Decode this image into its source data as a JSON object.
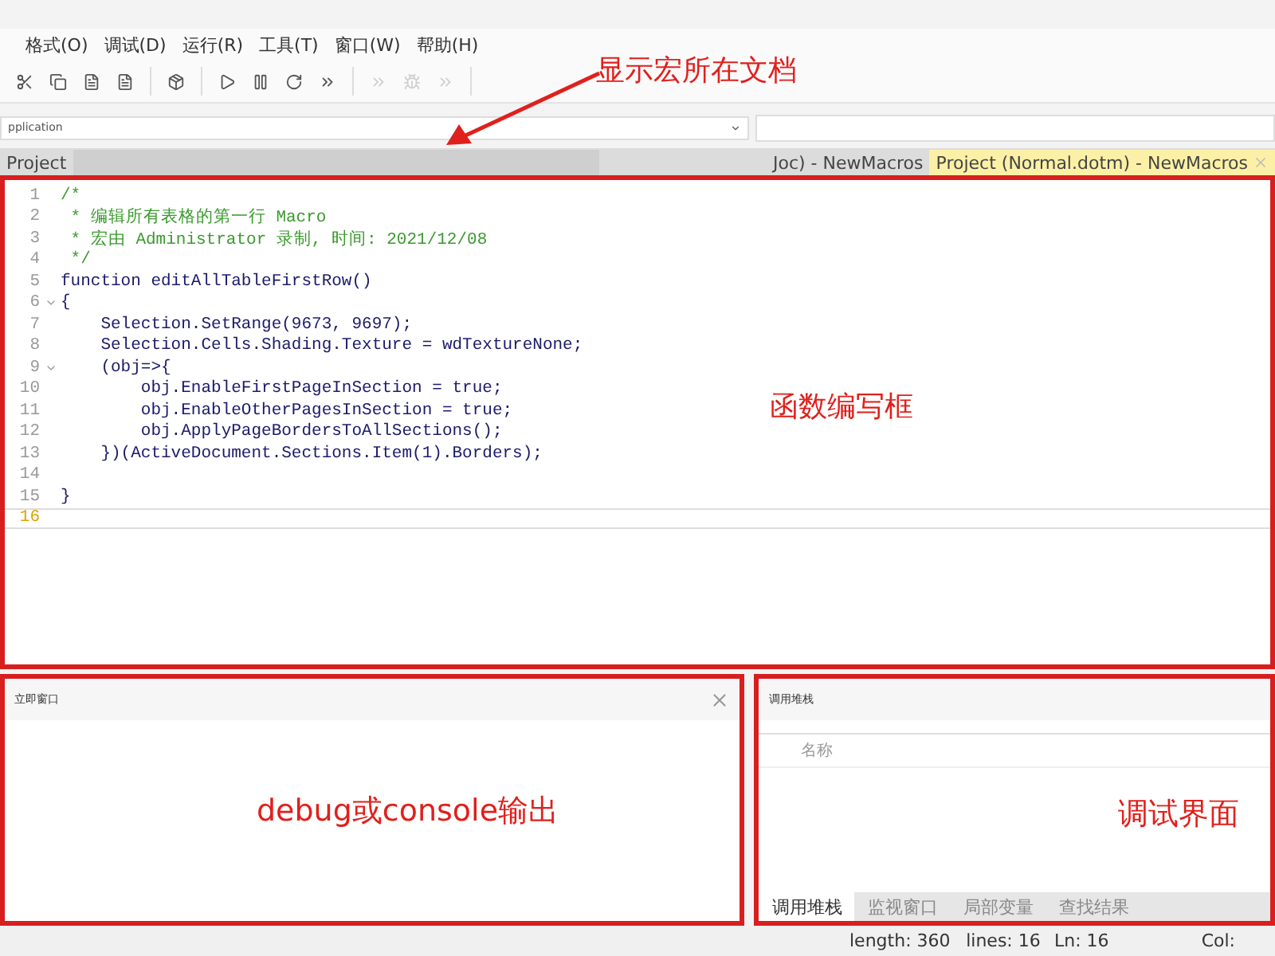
{
  "menu": [
    "格式(O)",
    "调试(D)",
    "运行(R)",
    "工具(T)",
    "窗口(W)",
    "帮助(H)"
  ],
  "toolbar": [
    [
      {
        "kind": "scissors",
        "disabled": false
      },
      {
        "kind": "copy",
        "disabled": false
      },
      {
        "kind": "form",
        "disabled": false
      },
      {
        "kind": "form",
        "disabled": false
      }
    ],
    [
      {
        "kind": "debug",
        "disabled": false
      }
    ],
    [
      {
        "kind": "play",
        "disabled": false
      },
      {
        "kind": "pause",
        "disabled": false
      },
      {
        "kind": "reset",
        "disabled": false
      },
      {
        "kind": "step",
        "disabled": false
      }
    ],
    [
      {
        "kind": "step",
        "disabled": true
      },
      {
        "kind": "bug",
        "disabled": true
      },
      {
        "kind": "step",
        "disabled": true
      }
    ]
  ],
  "annotation_top": "显示宏所在文档",
  "combo": {
    "value": "pplication"
  },
  "tabs": [
    {
      "label": "Project",
      "selected": false
    },
    {
      "label": "Joc) - NewMacros",
      "selected": false
    },
    {
      "label": "Project (Normal.dotm) - NewMacros",
      "selected": true
    }
  ],
  "editor": {
    "annotation": "函数编写框",
    "lines": [
      {
        "number": "1",
        "fold": false,
        "current": false,
        "kind": "comment",
        "text": "/*"
      },
      {
        "number": "2",
        "fold": false,
        "current": false,
        "kind": "comment",
        "text": " * 编辑所有表格的第一行 Macro"
      },
      {
        "number": "3",
        "fold": false,
        "current": false,
        "kind": "comment",
        "text": " * 宏由 Administrator 录制, 时间: 2021/12/08"
      },
      {
        "number": "4",
        "fold": false,
        "current": false,
        "kind": "comment",
        "text": " */"
      },
      {
        "number": "5",
        "fold": false,
        "current": false,
        "kind": "code",
        "text": "function editAllTableFirstRow()"
      },
      {
        "number": "6",
        "fold": true,
        "current": false,
        "kind": "code",
        "text": "{"
      },
      {
        "number": "7",
        "fold": false,
        "current": false,
        "kind": "code",
        "text": "    Selection.SetRange(9673, 9697);"
      },
      {
        "number": "8",
        "fold": false,
        "current": false,
        "kind": "code",
        "text": "    Selection.Cells.Shading.Texture = wdTextureNone;"
      },
      {
        "number": "9",
        "fold": true,
        "current": false,
        "kind": "code",
        "text": "    (obj=>{"
      },
      {
        "number": "10",
        "fold": false,
        "current": false,
        "kind": "code",
        "text": "        obj.EnableFirstPageInSection = true;"
      },
      {
        "number": "11",
        "fold": false,
        "current": false,
        "kind": "code",
        "text": "        obj.EnableOtherPagesInSection = true;"
      },
      {
        "number": "12",
        "fold": false,
        "current": false,
        "kind": "code",
        "text": "        obj.ApplyPageBordersToAllSections();"
      },
      {
        "number": "13",
        "fold": false,
        "current": false,
        "kind": "code",
        "text": "    })(ActiveDocument.Sections.Item(1).Borders);"
      },
      {
        "number": "14",
        "fold": false,
        "current": false
      },
      {
        "number": "15",
        "fold": false,
        "current": false,
        "kind": "code",
        "text": "}"
      },
      {
        "number": "16",
        "fold": false,
        "current": true
      }
    ]
  },
  "immediate": {
    "title": "立即窗口",
    "annotation": "debug或console输出"
  },
  "callstack": {
    "title": "调用堆栈",
    "column": "名称",
    "annotation": "调试界面",
    "tabs": [
      {
        "label": "调用堆栈",
        "selected": true
      },
      {
        "label": "监视窗口",
        "selected": false
      },
      {
        "label": "局部变量",
        "selected": false
      },
      {
        "label": "查找结果",
        "selected": false
      }
    ]
  },
  "status": [
    "length: 360",
    "lines: 16",
    "Ln: 16",
    "Col:"
  ]
}
